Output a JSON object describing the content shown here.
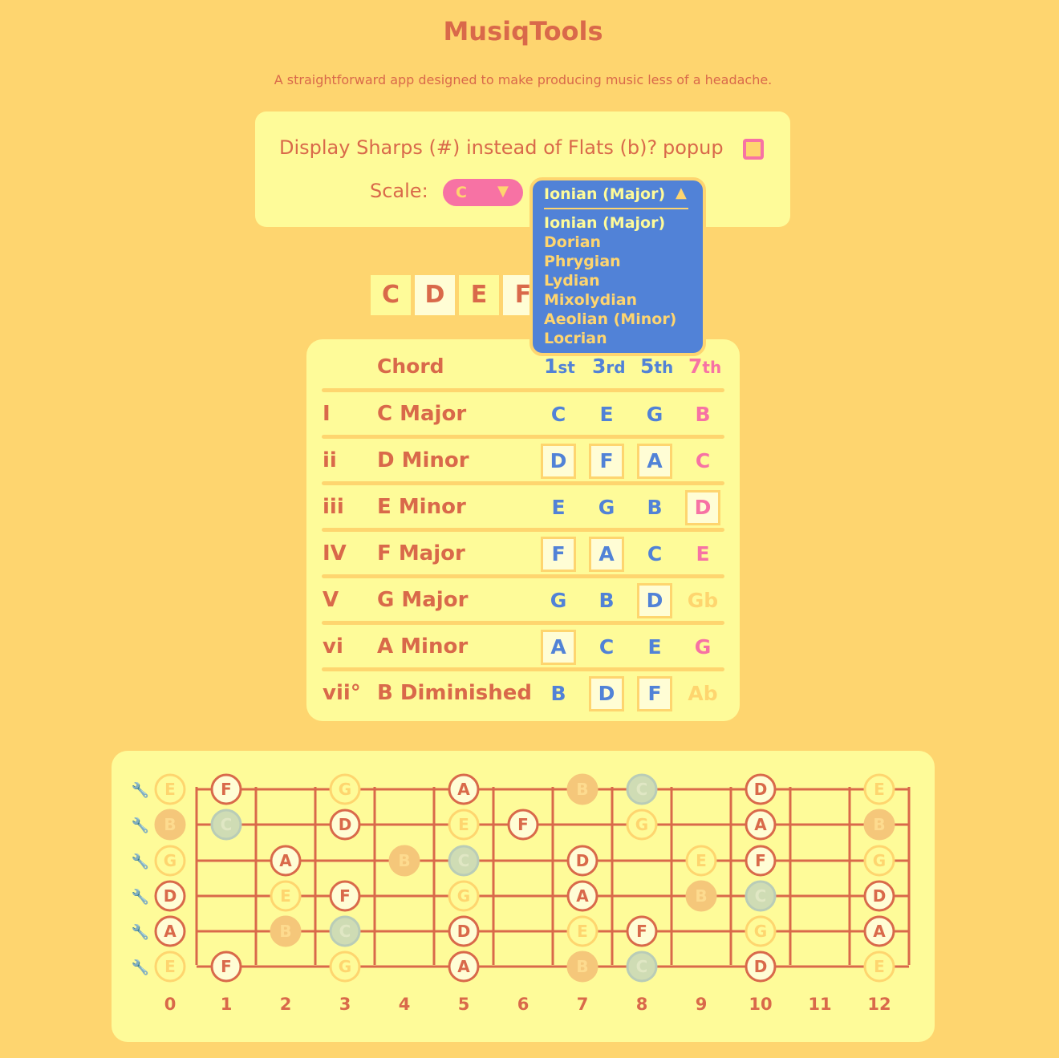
{
  "app": {
    "title": "MusiqTools",
    "subtitle": "A straightforward app designed to make producing music less of a headache."
  },
  "settings": {
    "sharps_label": "Display Sharps (#) instead of Flats (b)?",
    "popup_label": "popup",
    "sharps_checked": false,
    "scale_label": "Scale:",
    "key_value": "C",
    "mode_value": "Ionian (Major)",
    "mode_options": [
      "Ionian (Major)",
      "Dorian",
      "Phrygian",
      "Lydian",
      "Mixolydian",
      "Aeolian (Minor)",
      "Locrian"
    ]
  },
  "scale_notes": [
    "C",
    "D",
    "E",
    "F"
  ],
  "chord_table": {
    "header": {
      "chord": "Chord",
      "cols": [
        {
          "num": "1",
          "suffix": "st",
          "color": "#5182D7"
        },
        {
          "num": "3",
          "suffix": "rd",
          "color": "#5182D7"
        },
        {
          "num": "5",
          "suffix": "th",
          "color": "#5182D7"
        },
        {
          "num": "7",
          "suffix": "th",
          "color": "#F772A4"
        }
      ]
    },
    "rows": [
      {
        "numeral": "I",
        "name": "C Major",
        "notes": [
          "C",
          "E",
          "G",
          "B"
        ],
        "boxed": [
          false,
          false,
          false,
          false
        ],
        "seventh_out_of_scale": false
      },
      {
        "numeral": "ii",
        "name": "D Minor",
        "notes": [
          "D",
          "F",
          "A",
          "C"
        ],
        "boxed": [
          true,
          true,
          true,
          false
        ],
        "seventh_out_of_scale": false
      },
      {
        "numeral": "iii",
        "name": "E Minor",
        "notes": [
          "E",
          "G",
          "B",
          "D"
        ],
        "boxed": [
          false,
          false,
          false,
          true
        ],
        "seventh_out_of_scale": false
      },
      {
        "numeral": "IV",
        "name": "F Major",
        "notes": [
          "F",
          "A",
          "C",
          "E"
        ],
        "boxed": [
          true,
          true,
          false,
          false
        ],
        "seventh_out_of_scale": false
      },
      {
        "numeral": "V",
        "name": "G Major",
        "notes": [
          "G",
          "B",
          "D",
          "Gb"
        ],
        "boxed": [
          false,
          false,
          true,
          false
        ],
        "seventh_out_of_scale": true
      },
      {
        "numeral": "vi",
        "name": "A Minor",
        "notes": [
          "A",
          "C",
          "E",
          "G"
        ],
        "boxed": [
          true,
          false,
          false,
          false
        ],
        "seventh_out_of_scale": false
      },
      {
        "numeral": "vii°",
        "name": "B Diminished",
        "notes": [
          "B",
          "D",
          "F",
          "Ab"
        ],
        "boxed": [
          false,
          true,
          true,
          false
        ],
        "seventh_out_of_scale": true
      }
    ]
  },
  "fretboard": {
    "fret_numbers": [
      "0",
      "1",
      "2",
      "3",
      "4",
      "5",
      "6",
      "7",
      "8",
      "9",
      "10",
      "11",
      "12"
    ],
    "tuning_icon": "wrench-icon",
    "strings": [
      {
        "open": "E",
        "notes": [
          {
            "fret": 0,
            "note": "E",
            "style": "faded"
          },
          {
            "fret": 1,
            "note": "F",
            "style": "active"
          },
          {
            "fret": 3,
            "note": "G",
            "style": "faded"
          },
          {
            "fret": 5,
            "note": "A",
            "style": "active"
          },
          {
            "fret": 7,
            "note": "B",
            "style": "filled"
          },
          {
            "fret": 8,
            "note": "C",
            "style": "root"
          },
          {
            "fret": 10,
            "note": "D",
            "style": "active"
          },
          {
            "fret": 12,
            "note": "E",
            "style": "faded"
          }
        ]
      },
      {
        "open": "B",
        "notes": [
          {
            "fret": 0,
            "note": "B",
            "style": "filled"
          },
          {
            "fret": 1,
            "note": "C",
            "style": "root"
          },
          {
            "fret": 3,
            "note": "D",
            "style": "active"
          },
          {
            "fret": 5,
            "note": "E",
            "style": "faded"
          },
          {
            "fret": 6,
            "note": "F",
            "style": "active"
          },
          {
            "fret": 8,
            "note": "G",
            "style": "faded"
          },
          {
            "fret": 10,
            "note": "A",
            "style": "active"
          },
          {
            "fret": 12,
            "note": "B",
            "style": "filled"
          }
        ]
      },
      {
        "open": "G",
        "notes": [
          {
            "fret": 0,
            "note": "G",
            "style": "faded"
          },
          {
            "fret": 2,
            "note": "A",
            "style": "active"
          },
          {
            "fret": 4,
            "note": "B",
            "style": "filled"
          },
          {
            "fret": 5,
            "note": "C",
            "style": "root"
          },
          {
            "fret": 7,
            "note": "D",
            "style": "active"
          },
          {
            "fret": 9,
            "note": "E",
            "style": "faded"
          },
          {
            "fret": 10,
            "note": "F",
            "style": "active"
          },
          {
            "fret": 12,
            "note": "G",
            "style": "faded"
          }
        ]
      },
      {
        "open": "D",
        "notes": [
          {
            "fret": 0,
            "note": "D",
            "style": "active"
          },
          {
            "fret": 2,
            "note": "E",
            "style": "faded"
          },
          {
            "fret": 3,
            "note": "F",
            "style": "active"
          },
          {
            "fret": 5,
            "note": "G",
            "style": "faded"
          },
          {
            "fret": 7,
            "note": "A",
            "style": "active"
          },
          {
            "fret": 9,
            "note": "B",
            "style": "filled"
          },
          {
            "fret": 10,
            "note": "C",
            "style": "root"
          },
          {
            "fret": 12,
            "note": "D",
            "style": "active"
          }
        ]
      },
      {
        "open": "A",
        "notes": [
          {
            "fret": 0,
            "note": "A",
            "style": "active"
          },
          {
            "fret": 2,
            "note": "B",
            "style": "filled"
          },
          {
            "fret": 3,
            "note": "C",
            "style": "root"
          },
          {
            "fret": 5,
            "note": "D",
            "style": "active"
          },
          {
            "fret": 7,
            "note": "E",
            "style": "faded"
          },
          {
            "fret": 8,
            "note": "F",
            "style": "active"
          },
          {
            "fret": 10,
            "note": "G",
            "style": "faded"
          },
          {
            "fret": 12,
            "note": "A",
            "style": "active"
          }
        ]
      },
      {
        "open": "E",
        "notes": [
          {
            "fret": 0,
            "note": "E",
            "style": "faded"
          },
          {
            "fret": 1,
            "note": "F",
            "style": "active"
          },
          {
            "fret": 3,
            "note": "G",
            "style": "faded"
          },
          {
            "fret": 5,
            "note": "A",
            "style": "active"
          },
          {
            "fret": 7,
            "note": "B",
            "style": "filled"
          },
          {
            "fret": 8,
            "note": "C",
            "style": "root"
          },
          {
            "fret": 10,
            "note": "D",
            "style": "active"
          },
          {
            "fret": 12,
            "note": "E",
            "style": "faded"
          }
        ]
      }
    ]
  },
  "colors": {
    "background": "#FED56F",
    "panel": "#FEFB99",
    "accent_text": "#D9694A",
    "blue": "#5182D7",
    "pink": "#F772A4",
    "faded": "#FED56F"
  }
}
